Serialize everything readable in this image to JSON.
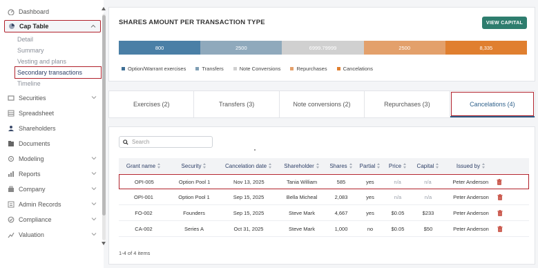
{
  "sidebar": {
    "items": [
      {
        "label": "Dashboard",
        "icon": "dashboard-icon"
      },
      {
        "label": "Cap Table",
        "icon": "pie-chart-icon",
        "expanded": true
      },
      {
        "label": "Securities",
        "icon": "securities-icon"
      },
      {
        "label": "Spreadsheet",
        "icon": "spreadsheet-icon"
      },
      {
        "label": "Shareholders",
        "icon": "users-icon"
      },
      {
        "label": "Documents",
        "icon": "document-icon"
      },
      {
        "label": "Modeling",
        "icon": "modeling-icon"
      },
      {
        "label": "Reports",
        "icon": "reports-icon"
      },
      {
        "label": "Company",
        "icon": "company-icon"
      },
      {
        "label": "Admin Records",
        "icon": "admin-icon"
      },
      {
        "label": "Compliance",
        "icon": "compliance-icon"
      },
      {
        "label": "Valuation",
        "icon": "valuation-icon"
      }
    ],
    "cap_table_sub": [
      "Detail",
      "Summary",
      "Vesting and plans",
      "Secondary transactions",
      "Timeline"
    ]
  },
  "chart": {
    "title": "SHARES AMOUNT PER TRANSACTION TYPE",
    "view_button": "VIEW CAPITAL",
    "segments": [
      {
        "label": "800",
        "color": "#4a7fa6",
        "share": 0.2
      },
      {
        "label": "2500",
        "color": "#8fa9bc",
        "share": 0.2
      },
      {
        "label": "6999.79999",
        "color": "#d0d0d0",
        "share": 0.2
      },
      {
        "label": "2500",
        "color": "#e3a06b",
        "share": 0.2
      },
      {
        "label": "8,335",
        "color": "#e07f2f",
        "share": 0.2
      }
    ],
    "legend": [
      {
        "label": "Option/Warrant exercises",
        "color": "#3f6f96"
      },
      {
        "label": "Transfers",
        "color": "#7f9fb5"
      },
      {
        "label": "Note Conversions",
        "color": "#cfcfcf"
      },
      {
        "label": "Repurchases",
        "color": "#e3a06b"
      },
      {
        "label": "Cancelations",
        "color": "#e07f2f"
      }
    ]
  },
  "tabs": [
    "Exercises (2)",
    "Transfers (3)",
    "Note conversions (2)",
    "Repurchases (3)",
    "Cancelations (4)"
  ],
  "table": {
    "search_placeholder": "Search",
    "headers": [
      "Grant name",
      "Security",
      "Cancelation date",
      "Shareholder",
      "Shares",
      "Partial",
      "Price",
      "Capital",
      "Issued by"
    ],
    "rows": [
      [
        "OPI-005",
        "Option Pool 1",
        "Nov 13, 2025",
        "Tania William",
        "585",
        "yes",
        "n/a",
        "n/a",
        "Peter Anderson"
      ],
      [
        "OPI-001",
        "Option Pool 1",
        "Sep 15, 2025",
        "Bella Micheal",
        "2,083",
        "yes",
        "n/a",
        "n/a",
        "Peter Anderson"
      ],
      [
        "FO-002",
        "Founders",
        "Sep 15, 2025",
        "Steve Mark",
        "4,667",
        "yes",
        "$0.05",
        "$233",
        "Peter Anderson"
      ],
      [
        "CA-002",
        "Series A",
        "Oct 31, 2025",
        "Steve Mark",
        "1,000",
        "no",
        "$0.05",
        "$50",
        "Peter Anderson"
      ]
    ],
    "footer": "1-4 of 4 items"
  },
  "colors": {
    "accent": "#2e7d6e",
    "highlight": "#b0202a",
    "link": "#2c5f8a"
  }
}
